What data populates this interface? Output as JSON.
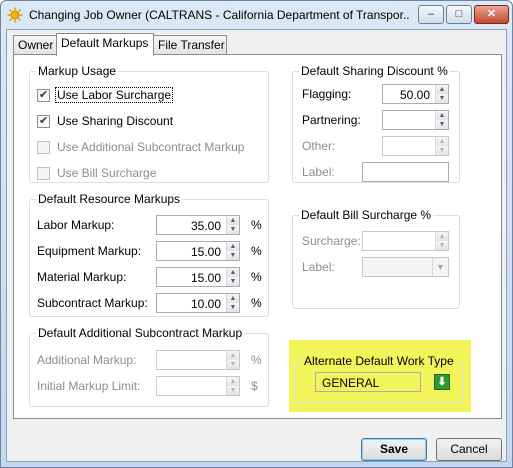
{
  "window": {
    "title": "Changing Job Owner  (CALTRANS - California Department of Transpor...",
    "min_label": "–",
    "max_label": "□",
    "close_label": "✕"
  },
  "tabs": [
    {
      "label": "Owner"
    },
    {
      "label": "Default Markups"
    },
    {
      "label": "File Transfer"
    }
  ],
  "markup_usage": {
    "title": "Markup Usage",
    "items": [
      {
        "label": "Use Labor Surcharge",
        "checked": true,
        "enabled": true
      },
      {
        "label": "Use Sharing Discount",
        "checked": true,
        "enabled": true
      },
      {
        "label": "Use Additional Subcontract Markup",
        "checked": false,
        "enabled": false
      },
      {
        "label": "Use Bill Surcharge",
        "checked": false,
        "enabled": false
      }
    ]
  },
  "sharing_discount": {
    "title": "Default Sharing Discount %",
    "flagging_label": "Flagging:",
    "flagging_value": "50.00",
    "partnering_label": "Partnering:",
    "partnering_value": "",
    "other_label": "Other:",
    "other_value": "",
    "label_label": "Label:",
    "label_value": ""
  },
  "resource_markups": {
    "title": "Default Resource Markups",
    "rows": [
      {
        "label": "Labor Markup:",
        "value": "35.00",
        "unit": "%"
      },
      {
        "label": "Equipment Markup:",
        "value": "15.00",
        "unit": "%"
      },
      {
        "label": "Material Markup:",
        "value": "15.00",
        "unit": "%"
      },
      {
        "label": "Subcontract Markup:",
        "value": "10.00",
        "unit": "%"
      }
    ]
  },
  "bill_surcharge": {
    "title": "Default Bill Surcharge %",
    "surcharge_label": "Surcharge:",
    "surcharge_value": "",
    "label_label": "Label:",
    "label_value": ""
  },
  "additional_subcontract": {
    "title": "Default Additional Subcontract Markup",
    "additional_label": "Additional Markup:",
    "additional_value": "",
    "additional_unit": "%",
    "limit_label": "Initial Markup Limit:",
    "limit_value": "",
    "limit_unit": "$"
  },
  "work_type": {
    "title": "Alternate Default Work Type",
    "value": "GENERAL",
    "button_icon": "green-down-arrow-icon",
    "highlight_color": "#f3f35a"
  },
  "buttons": {
    "save": "Save",
    "cancel": "Cancel"
  }
}
